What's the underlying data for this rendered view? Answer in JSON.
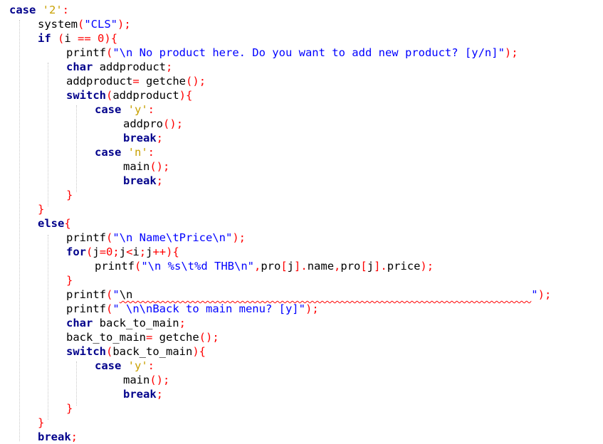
{
  "editor": {
    "lines": [
      {
        "tokens": [
          [
            "k",
            "case"
          ],
          [
            "p",
            " "
          ],
          [
            "c",
            "'2'"
          ],
          [
            "o",
            ":"
          ]
        ]
      },
      {
        "tokens": [
          [
            "p",
            "system"
          ],
          [
            "o",
            "("
          ],
          [
            "s",
            "\"CLS\""
          ],
          [
            "o",
            ")"
          ],
          [
            "o",
            ";"
          ]
        ]
      },
      {
        "tokens": [
          [
            "k",
            "if"
          ],
          [
            "p",
            " "
          ],
          [
            "o",
            "("
          ],
          [
            "p",
            "i "
          ],
          [
            "o",
            "=="
          ],
          [
            "p",
            " "
          ],
          [
            "n",
            "0"
          ],
          [
            "o",
            ")"
          ],
          [
            "o",
            "{"
          ]
        ]
      },
      {
        "tokens": [
          [
            "p",
            "printf"
          ],
          [
            "o",
            "("
          ],
          [
            "s",
            "\"\\n No product here. Do you want to add new product? [y/n]\""
          ],
          [
            "o",
            ")"
          ],
          [
            "o",
            ";"
          ]
        ]
      },
      {
        "tokens": [
          [
            "k",
            "char"
          ],
          [
            "p",
            " addproduct"
          ],
          [
            "o",
            ";"
          ]
        ]
      },
      {
        "tokens": [
          [
            "p",
            "addproduct"
          ],
          [
            "o",
            "="
          ],
          [
            "p",
            " getche"
          ],
          [
            "o",
            "("
          ],
          [
            "o",
            ")"
          ],
          [
            "o",
            ";"
          ]
        ]
      },
      {
        "tokens": [
          [
            "k",
            "switch"
          ],
          [
            "o",
            "("
          ],
          [
            "p",
            "addproduct"
          ],
          [
            "o",
            ")"
          ],
          [
            "o",
            "{"
          ]
        ]
      },
      {
        "tokens": [
          [
            "k",
            "case"
          ],
          [
            "p",
            " "
          ],
          [
            "c",
            "'y'"
          ],
          [
            "o",
            ":"
          ]
        ]
      },
      {
        "tokens": [
          [
            "p",
            "addpro"
          ],
          [
            "o",
            "("
          ],
          [
            "o",
            ")"
          ],
          [
            "o",
            ";"
          ]
        ]
      },
      {
        "tokens": [
          [
            "k",
            "break"
          ],
          [
            "o",
            ";"
          ]
        ]
      },
      {
        "tokens": [
          [
            "k",
            "case"
          ],
          [
            "p",
            " "
          ],
          [
            "c",
            "'n'"
          ],
          [
            "o",
            ":"
          ]
        ]
      },
      {
        "tokens": [
          [
            "p",
            "main"
          ],
          [
            "o",
            "("
          ],
          [
            "o",
            ")"
          ],
          [
            "o",
            ";"
          ]
        ]
      },
      {
        "tokens": [
          [
            "k",
            "break"
          ],
          [
            "o",
            ";"
          ]
        ]
      },
      {
        "tokens": [
          [
            "o",
            "}"
          ]
        ]
      },
      {
        "tokens": [
          [
            "o",
            "}"
          ]
        ]
      },
      {
        "tokens": [
          [
            "k",
            "else"
          ],
          [
            "o",
            "{"
          ]
        ]
      },
      {
        "tokens": [
          [
            "p",
            "printf"
          ],
          [
            "o",
            "("
          ],
          [
            "s",
            "\"\\n Name\\tPrice\\n\""
          ],
          [
            "o",
            ")"
          ],
          [
            "o",
            ";"
          ]
        ]
      },
      {
        "tokens": [
          [
            "k",
            "for"
          ],
          [
            "o",
            "("
          ],
          [
            "p",
            "j"
          ],
          [
            "o",
            "="
          ],
          [
            "n",
            "0"
          ],
          [
            "o",
            ";"
          ],
          [
            "p",
            "j"
          ],
          [
            "o",
            "<"
          ],
          [
            "p",
            "i"
          ],
          [
            "o",
            ";"
          ],
          [
            "p",
            "j"
          ],
          [
            "o",
            "++"
          ],
          [
            "o",
            ")"
          ],
          [
            "o",
            "{"
          ]
        ]
      },
      {
        "tokens": [
          [
            "p",
            "printf"
          ],
          [
            "o",
            "("
          ],
          [
            "s",
            "\"\\n %s\\t%d THB\\n\""
          ],
          [
            "o",
            ","
          ],
          [
            "p",
            "pro"
          ],
          [
            "o",
            "["
          ],
          [
            "p",
            "j"
          ],
          [
            "o",
            "]"
          ],
          [
            "o",
            "."
          ],
          [
            "p",
            "name"
          ],
          [
            "o",
            ","
          ],
          [
            "p",
            "pro"
          ],
          [
            "o",
            "["
          ],
          [
            "p",
            "j"
          ],
          [
            "o",
            "]"
          ],
          [
            "o",
            "."
          ],
          [
            "p",
            "price"
          ],
          [
            "o",
            ")"
          ],
          [
            "o",
            ";"
          ]
        ]
      },
      {
        "tokens": [
          [
            "o",
            "}"
          ]
        ]
      },
      {
        "tokens": [
          [
            "p",
            "printf"
          ],
          [
            "o",
            "("
          ],
          [
            "s",
            "\""
          ],
          [
            "sq",
            "\\n                                                            "
          ],
          [
            "s",
            "\""
          ],
          [
            "o",
            ")"
          ],
          [
            "o",
            ";"
          ]
        ]
      },
      {
        "tokens": [
          [
            "p",
            "printf"
          ],
          [
            "o",
            "("
          ],
          [
            "s",
            "\" \\n\\nBack to main menu? [y]\""
          ],
          [
            "o",
            ")"
          ],
          [
            "o",
            ";"
          ]
        ]
      },
      {
        "tokens": [
          [
            "k",
            "char"
          ],
          [
            "p",
            " back_to_main"
          ],
          [
            "o",
            ";"
          ]
        ]
      },
      {
        "tokens": [
          [
            "p",
            "back_to_main"
          ],
          [
            "o",
            "="
          ],
          [
            "p",
            " getche"
          ],
          [
            "o",
            "("
          ],
          [
            "o",
            ")"
          ],
          [
            "o",
            ";"
          ]
        ]
      },
      {
        "tokens": [
          [
            "k",
            "switch"
          ],
          [
            "o",
            "("
          ],
          [
            "p",
            "back_to_main"
          ],
          [
            "o",
            ")"
          ],
          [
            "o",
            "{"
          ]
        ]
      },
      {
        "tokens": [
          [
            "k",
            "case"
          ],
          [
            "p",
            " "
          ],
          [
            "c",
            "'y'"
          ],
          [
            "o",
            ":"
          ]
        ]
      },
      {
        "tokens": [
          [
            "p",
            "main"
          ],
          [
            "o",
            "("
          ],
          [
            "o",
            ")"
          ],
          [
            "o",
            ";"
          ]
        ]
      },
      {
        "tokens": [
          [
            "k",
            "break"
          ],
          [
            "o",
            ";"
          ]
        ]
      },
      {
        "tokens": [
          [
            "o",
            "}"
          ]
        ]
      },
      {
        "tokens": [
          [
            "o",
            "}"
          ]
        ]
      },
      {
        "tokens": [
          [
            "k",
            "break"
          ],
          [
            "o",
            ";"
          ]
        ]
      }
    ]
  },
  "colors": {
    "keyword": "#00008b",
    "string": "#0000ff",
    "number": "#ff0000",
    "operator": "#ff0000",
    "char": "#c8a000",
    "background": "#ffffff"
  }
}
